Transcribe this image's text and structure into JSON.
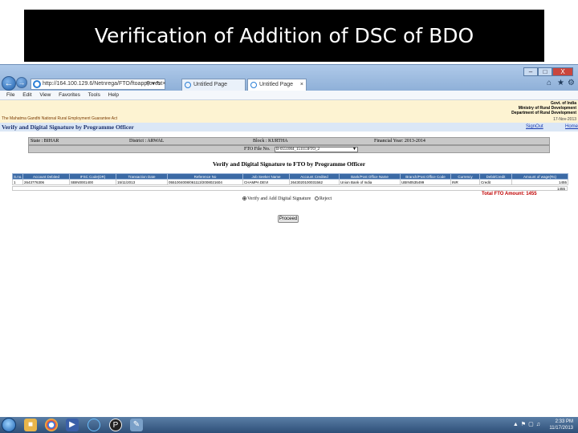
{
  "slide": {
    "title": "Verification of Addition of DSC of BDO"
  },
  "browser": {
    "address": "http://164.100.129.6/Netnrega/FTO/ftoapprovest",
    "tabs": [
      {
        "label": "Untitled Page"
      },
      {
        "label": "Untitled Page"
      }
    ],
    "menu": [
      "File",
      "Edit",
      "View",
      "Favorites",
      "Tools",
      "Help"
    ],
    "window_controls": {
      "minimize": "–",
      "maximize": "□",
      "close": "X"
    }
  },
  "page": {
    "banner": {
      "left_text": "The Mahatma Gandhi National Rural Employment Guarantee Act",
      "gov_lines": [
        "Govt. of India",
        "Ministry of Rural Development",
        "Department of Rural Development"
      ],
      "date": "17-Nov-2013"
    },
    "heading": "Verify and Digital Signature by Programme Officer",
    "signout": "SignOut",
    "home": "Home",
    "info": {
      "state": "State : BIHAR",
      "district": "District : ARWAL",
      "block": "Block : KURTHA",
      "financial_year": "Financial Year: 2013-2014"
    },
    "fto": {
      "label": "FTO File No.",
      "value": "B-0551004_151113FTO_2"
    },
    "form_title": "Verify and Digital Signature to FTO by Programme Officer",
    "table": {
      "headers": [
        "S.no.",
        "Account Debited",
        "IFSC Code(DR)",
        "Transaction Date",
        "Reference No",
        "Job Seeker Name",
        "Account Credited",
        "Bank/Post Office Name",
        "Branch/Post Office Code",
        "Currency",
        "Debit/Credit",
        "Amount of wage(Rs)"
      ],
      "rows": [
        [
          "1",
          "2643776306",
          "SBIN0001400",
          "15/11/2013",
          "0551004008/061113/2008021604",
          "CHAMPA DEVI",
          "2643020100031562",
          "Union Bank of India",
          "UBIN0535499",
          "INR",
          "Credit",
          "1455"
        ]
      ],
      "subtotal": "1455"
    },
    "total_label": "Total FTO Amount: 1455",
    "options": {
      "verify": "Verify and Add Digital Signature",
      "reject": "Reject"
    },
    "proceed": "Proceed"
  },
  "taskbar": {
    "time": "2:33 PM",
    "date": "11/17/2013"
  }
}
